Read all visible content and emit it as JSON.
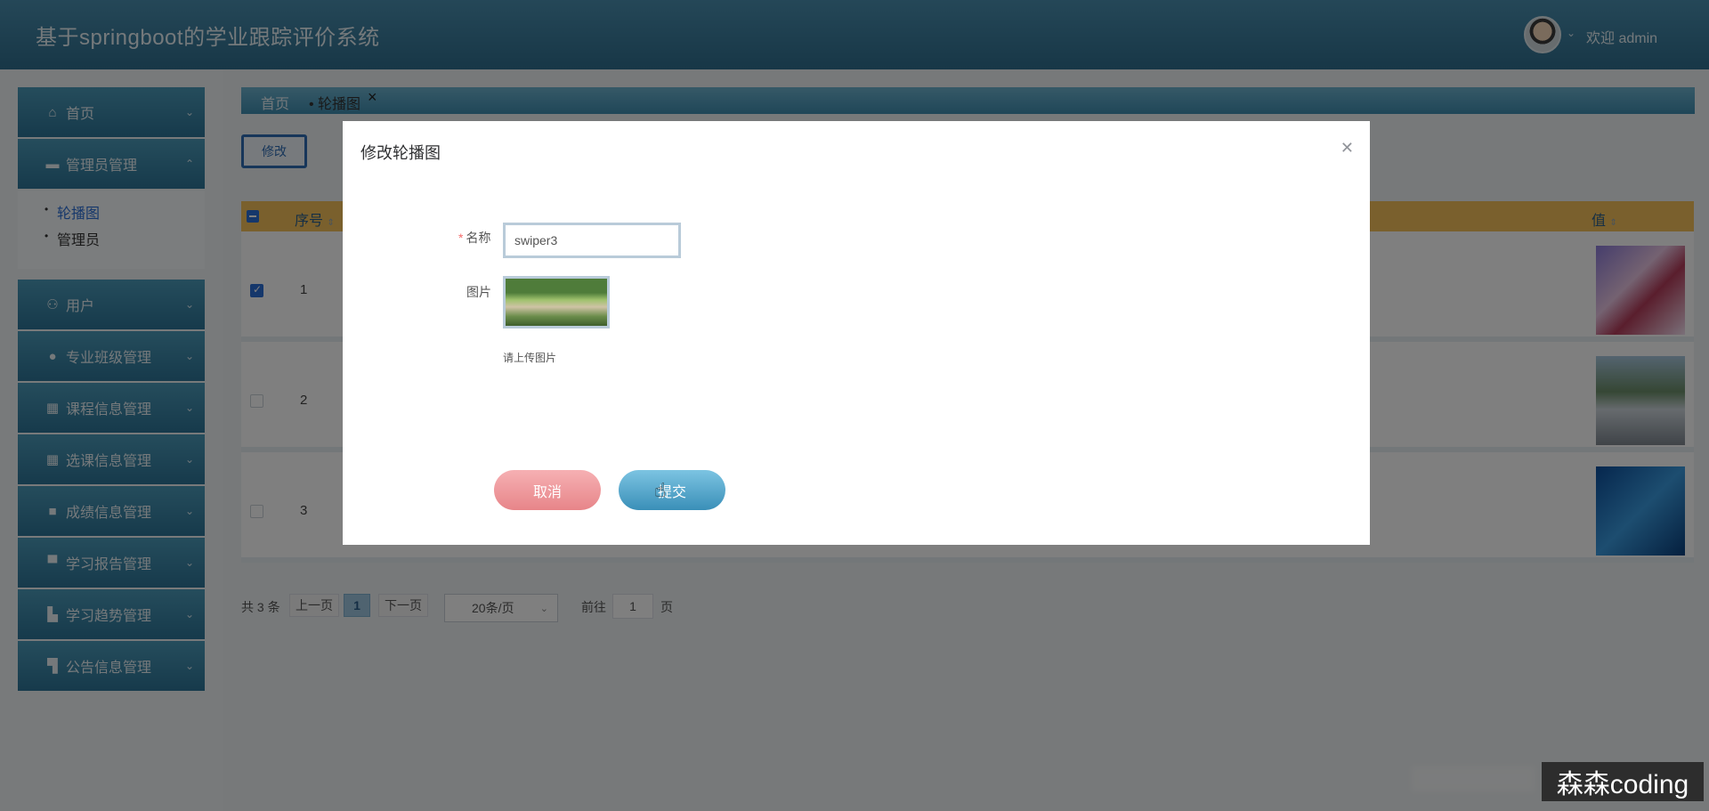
{
  "header": {
    "title": "基于springboot的学业跟踪评价系统",
    "welcome": "欢迎 admin"
  },
  "sidebar": {
    "items": [
      {
        "label": "首页",
        "icon": "home-icon"
      },
      {
        "label": "管理员管理",
        "icon": "folder-icon",
        "expanded": true
      },
      {
        "label": "用户",
        "icon": "user-icon"
      },
      {
        "label": "专业班级管理",
        "icon": "more-circle-icon"
      },
      {
        "label": "课程信息管理",
        "icon": "grid-icon"
      },
      {
        "label": "选课信息管理",
        "icon": "grid-icon"
      },
      {
        "label": "成绩信息管理",
        "icon": "apps-icon"
      },
      {
        "label": "学习报告管理",
        "icon": "panel-icon"
      },
      {
        "label": "学习趋势管理",
        "icon": "chart-icon"
      },
      {
        "label": "公告信息管理",
        "icon": "layout-icon"
      }
    ],
    "submenu": [
      {
        "label": "轮播图",
        "active": true
      },
      {
        "label": "管理员",
        "active": false
      }
    ]
  },
  "tags": {
    "home": "首页",
    "current": "轮播图"
  },
  "toolbar": {
    "edit_label": "修改"
  },
  "table": {
    "headers": {
      "seq": "序号",
      "value": "值"
    },
    "rows": [
      {
        "seq": "1",
        "checked": true
      },
      {
        "seq": "2",
        "checked": false
      },
      {
        "seq": "3",
        "checked": false
      }
    ]
  },
  "pager": {
    "total": "共 3 条",
    "prev": "上一页",
    "current": "1",
    "next": "下一页",
    "page_size": "20条/页",
    "goto_label": "前往",
    "goto_value": "1",
    "page_unit": "页"
  },
  "dialog": {
    "title": "修改轮播图",
    "name_label": "名称",
    "name_value": "swiper3",
    "pic_label": "图片",
    "pic_hint": "请上传图片",
    "cancel_label": "取消",
    "submit_label": "提交"
  },
  "watermark": "森森coding"
}
